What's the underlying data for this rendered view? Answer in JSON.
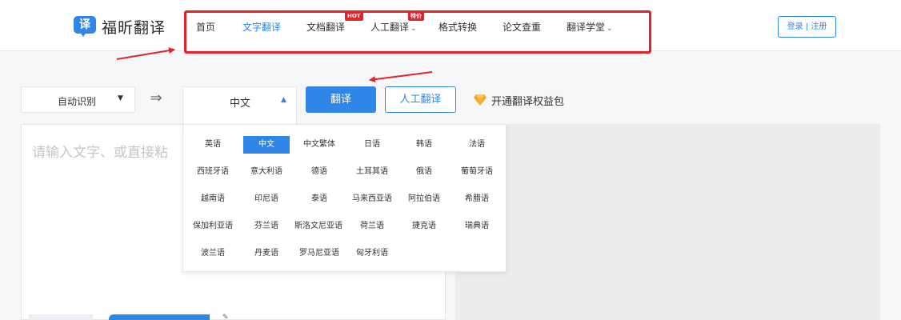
{
  "header": {
    "logo_char": "译",
    "logo_text": "福昕翻译",
    "nav": [
      {
        "label": "首页"
      },
      {
        "label": "文字翻译"
      },
      {
        "label": "文档翻译",
        "tag": "HOT"
      },
      {
        "label": "人工翻译",
        "tag": "特价"
      },
      {
        "label": "格式转换"
      },
      {
        "label": "论文查重"
      },
      {
        "label": "翻译学堂"
      }
    ],
    "auth_label": "登录 | 注册"
  },
  "toolbar": {
    "source_lang": "自动识别",
    "target_lang": "中文",
    "swap_icon": "⇒",
    "translate_label": "翻译",
    "human_translate_label": "人工翻译",
    "vip_label": "开通翻译权益包"
  },
  "input": {
    "placeholder": "请输入文字、或直接粘"
  },
  "dropdown": {
    "languages": [
      {
        "label": "英语"
      },
      {
        "label": "中文",
        "selected": true
      },
      {
        "label": "中文繁体"
      },
      {
        "label": "日语"
      },
      {
        "label": "韩语"
      },
      {
        "label": "法语"
      },
      {
        "label": "西班牙语"
      },
      {
        "label": "意大利语"
      },
      {
        "label": "德语"
      },
      {
        "label": "土耳其语"
      },
      {
        "label": "俄语"
      },
      {
        "label": "葡萄牙语"
      },
      {
        "label": "越南语"
      },
      {
        "label": "印尼语"
      },
      {
        "label": "泰语"
      },
      {
        "label": "马来西亚语"
      },
      {
        "label": "阿拉伯语"
      },
      {
        "label": "希腊语"
      },
      {
        "label": "保加利亚语"
      },
      {
        "label": "芬兰语"
      },
      {
        "label": "斯洛文尼亚语"
      },
      {
        "label": "荷兰语"
      },
      {
        "label": "捷克语"
      },
      {
        "label": "瑞典语"
      },
      {
        "label": "波兰语"
      },
      {
        "label": "丹麦语"
      },
      {
        "label": "罗马尼亚语"
      },
      {
        "label": "匈牙利语"
      }
    ]
  },
  "colors": {
    "accent": "#2e86e8",
    "highlight": "#e0242a",
    "vip_icon": "#f5a623"
  }
}
